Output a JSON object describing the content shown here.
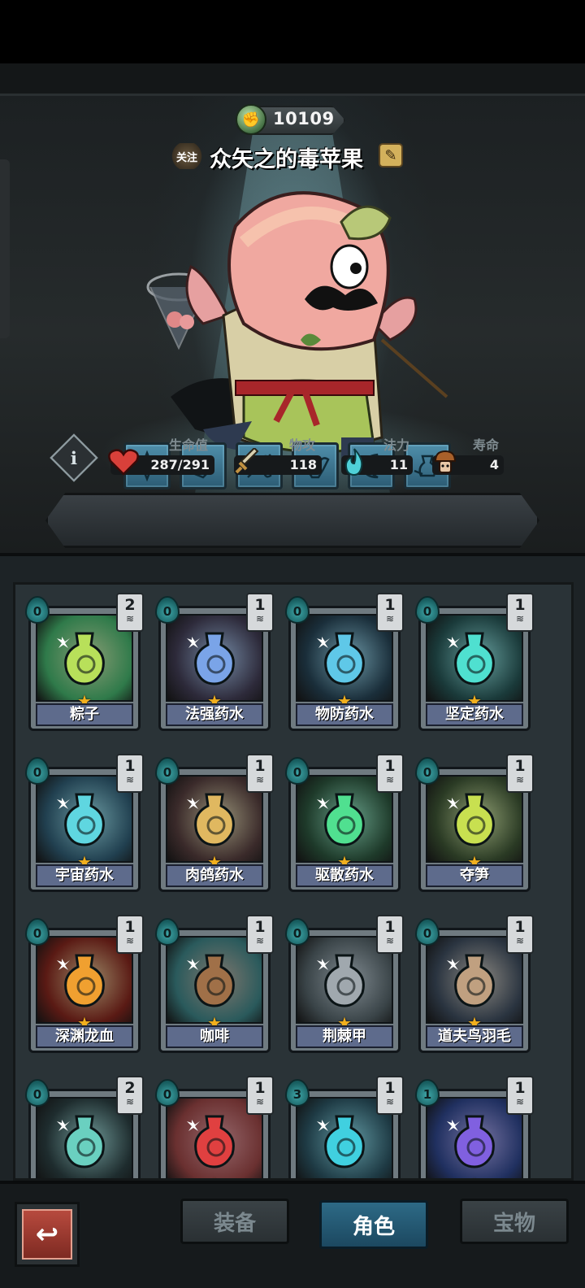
{
  "header": {
    "currency_value": "10109",
    "follow_label": "关注",
    "hero_name": "众矢之的毒苹果"
  },
  "skills": [
    {
      "icon": "lotus-icon"
    },
    {
      "icon": "fist-icon"
    },
    {
      "icon": "herb-icon"
    },
    {
      "icon": "muscle-icon"
    },
    {
      "icon": "moon-heart-icon"
    },
    {
      "icon": "potion-hand-icon"
    }
  ],
  "stats": {
    "hp_label": "生命值",
    "hp_value": "287/291",
    "atk_label": "物攻",
    "atk_value": "118",
    "mana_label": "法力",
    "mana_value": "11",
    "life_label": "寿命",
    "life_value": "4"
  },
  "items": [
    {
      "name": "粽子",
      "cost": "0",
      "qty": "2",
      "bg": "#2f7a4a",
      "accent": "#b8e05a"
    },
    {
      "name": "法强药水",
      "cost": "0",
      "qty": "1",
      "bg": "#2d2a3a",
      "accent": "#7aa4e8"
    },
    {
      "name": "物防药水",
      "cost": "0",
      "qty": "1",
      "bg": "#1a2e3a",
      "accent": "#5fc8e8"
    },
    {
      "name": "坚定药水",
      "cost": "0",
      "qty": "1",
      "bg": "#1a3a3a",
      "accent": "#4fe0d0"
    },
    {
      "name": "宇宙药水",
      "cost": "0",
      "qty": "1",
      "bg": "#214050",
      "accent": "#5fd6e0"
    },
    {
      "name": "肉鸽药水",
      "cost": "0",
      "qty": "1",
      "bg": "#3a2a2a",
      "accent": "#e0b860"
    },
    {
      "name": "驱散药水",
      "cost": "0",
      "qty": "1",
      "bg": "#1e3a2a",
      "accent": "#50e090"
    },
    {
      "name": "夺笋",
      "cost": "0",
      "qty": "1",
      "bg": "#2a3a24",
      "accent": "#c8e050"
    },
    {
      "name": "深渊龙血",
      "cost": "0",
      "qty": "1",
      "bg": "#5a1a14",
      "accent": "#f0a030"
    },
    {
      "name": "咖啡",
      "cost": "0",
      "qty": "1",
      "bg": "#2a5a5c",
      "accent": "#a07048"
    },
    {
      "name": "荆棘甲",
      "cost": "0",
      "qty": "1",
      "bg": "#3a4448",
      "accent": "#a0a8ae"
    },
    {
      "name": "道夫鸟羽毛",
      "cost": "0",
      "qty": "1",
      "bg": "#2a3440",
      "accent": "#c0a080"
    },
    {
      "name": "",
      "cost": "0",
      "qty": "2",
      "bg": "#1e2c2e",
      "accent": "#6ad0c0"
    },
    {
      "name": "",
      "cost": "0",
      "qty": "1",
      "bg": "#6a3030",
      "accent": "#e04040"
    },
    {
      "name": "",
      "cost": "3",
      "qty": "1",
      "bg": "#1e3a44",
      "accent": "#40d0e0"
    },
    {
      "name": "",
      "cost": "1",
      "qty": "1",
      "bg": "#203060",
      "accent": "#8060e0"
    }
  ],
  "nav": {
    "back_label": "↩",
    "tabs": [
      {
        "label": "装备"
      },
      {
        "label": "角色"
      },
      {
        "label": "宝物"
      }
    ]
  }
}
